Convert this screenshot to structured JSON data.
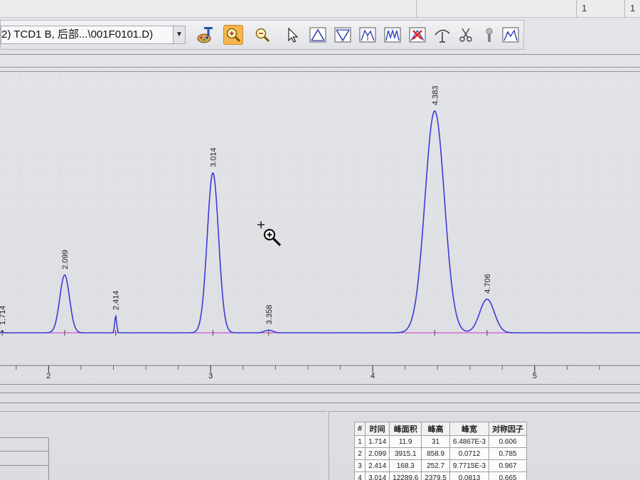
{
  "top": {
    "cells": [
      "1",
      "1"
    ]
  },
  "toolbar": {
    "signal_select_value": "2) TCD1 B, 后部...\\001F0101.D)",
    "tools": [
      {
        "icon": "palette-text-icon"
      },
      {
        "icon": "zoom-in-icon"
      },
      {
        "icon": "zoom-out-icon"
      },
      {
        "icon": "pointer-icon"
      },
      {
        "icon": "baseline-peak-icon"
      },
      {
        "icon": "inverted-peak-icon"
      },
      {
        "icon": "split-peak-icon"
      },
      {
        "icon": "multi-peak-icon"
      },
      {
        "icon": "delete-peak-icon"
      },
      {
        "icon": "tangent-skim-icon"
      },
      {
        "icon": "scissors-icon"
      },
      {
        "icon": "tool-icon"
      },
      {
        "icon": "chart-label-icon"
      }
    ],
    "accent": "#f6b54d"
  },
  "chart_data": {
    "type": "line",
    "title": "",
    "xlabel": "",
    "ylabel": "",
    "x_ticks": [
      "2",
      "3",
      "4",
      "5"
    ],
    "xlim": [
      1.7,
      5.65
    ],
    "peaks": [
      {
        "label": "1.714",
        "time": 1.714,
        "height": 31
      },
      {
        "label": "2.099",
        "time": 2.099,
        "height": 858.9
      },
      {
        "label": "2.414",
        "time": 2.414,
        "height": 252.7
      },
      {
        "label": "3.014",
        "time": 3.014,
        "height": 2379.5
      },
      {
        "label": "3.358",
        "time": 3.358,
        "height": 40
      },
      {
        "label": "4.383",
        "time": 4.383,
        "height": 3300
      },
      {
        "label": "4.706",
        "time": 4.706,
        "height": 500
      }
    ],
    "trace_color": "#3b3bd6",
    "baseline_color": "#cc33cc",
    "grid": true
  },
  "results_table": {
    "headers": [
      "#",
      "时间",
      "峰面积",
      "峰高",
      "峰宽",
      "对称因子"
    ],
    "rows": [
      [
        "1",
        "1.714",
        "11.9",
        "31",
        "6.4867E-3",
        "0.606"
      ],
      [
        "2",
        "2.099",
        "3915.1",
        "858.9",
        "0.0712",
        "0.785"
      ],
      [
        "3",
        "2.414",
        "168.3",
        "252.7",
        "9.7715E-3",
        "0.967"
      ],
      [
        "4",
        "3.014",
        "12289.6",
        "2379.5",
        "0.0813",
        "0.665"
      ]
    ]
  },
  "cursor": {
    "icon": "zoom-cursor-icon"
  }
}
